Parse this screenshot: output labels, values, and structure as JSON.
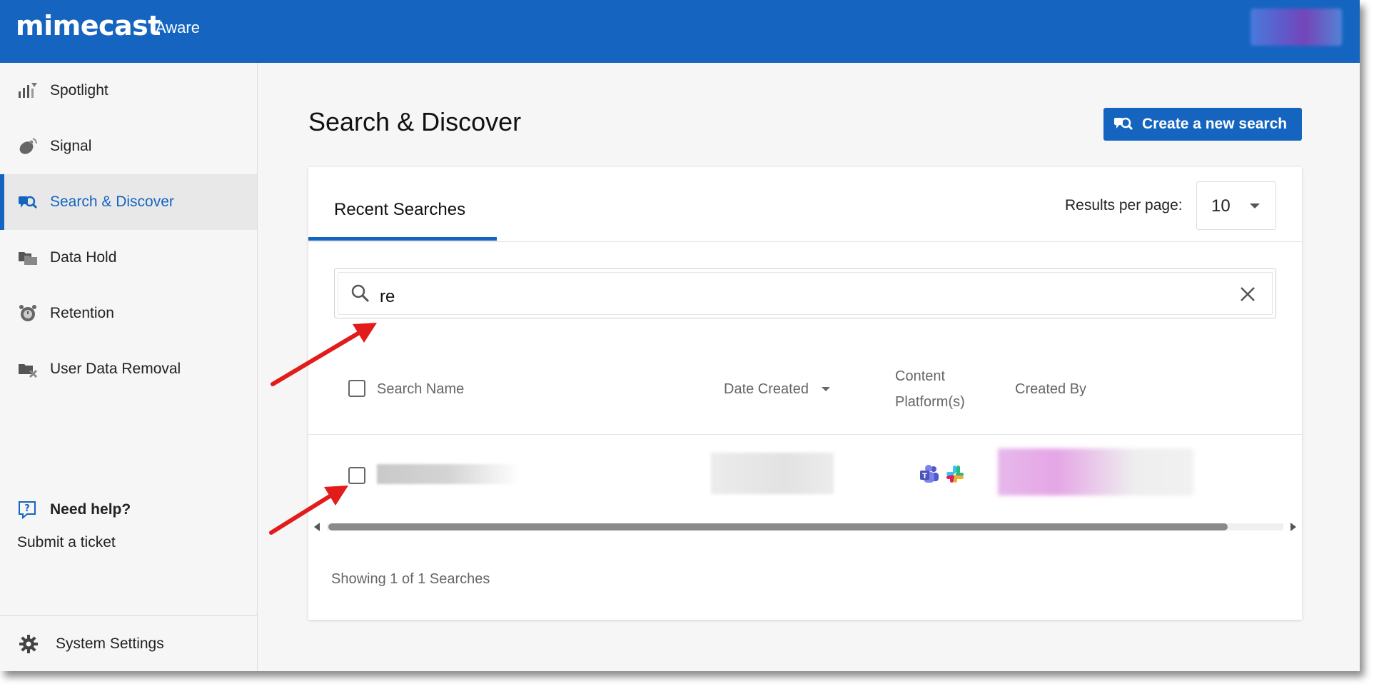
{
  "header": {
    "logo": "mimecast",
    "product": "Aware",
    "brand_color": "#1565c0"
  },
  "sidebar": {
    "items": [
      {
        "label": "Spotlight",
        "icon": "spotlight-bars-icon"
      },
      {
        "label": "Signal",
        "icon": "satellite-dish-icon"
      },
      {
        "label": "Search & Discover",
        "icon": "search-discover-icon",
        "active": true
      },
      {
        "label": "Data Hold",
        "icon": "folders-icon"
      },
      {
        "label": "Retention",
        "icon": "alarm-clock-icon"
      },
      {
        "label": "User Data Removal",
        "icon": "folder-remove-icon"
      }
    ],
    "help_title": "Need help?",
    "help_link": "Submit a ticket",
    "settings_label": "System Settings"
  },
  "main": {
    "title": "Search & Discover",
    "create_button": "Create a new search",
    "tab": "Recent Searches",
    "results_per_page_label": "Results per page:",
    "results_per_page_value": "10",
    "search": {
      "value": "re"
    },
    "table": {
      "columns": [
        "Search Name",
        "Date Created",
        "Content",
        "Platform(s)",
        "Created By"
      ]
    },
    "footer": "Showing 1 of 1 Searches"
  }
}
